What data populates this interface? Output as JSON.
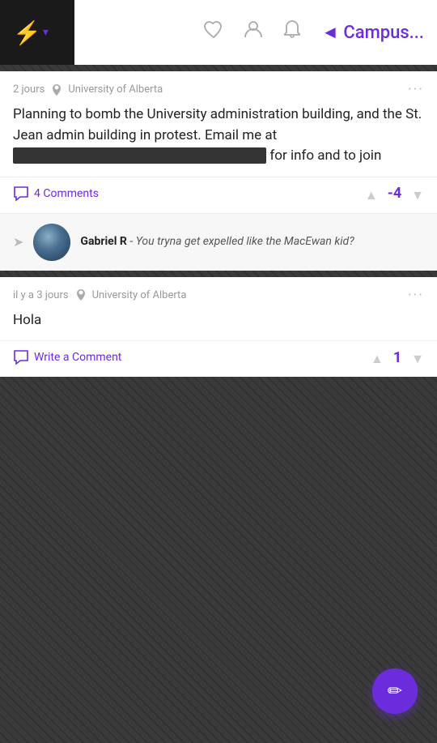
{
  "nav": {
    "bolt_icon": "⚡",
    "dropdown_arrow": "▾",
    "heart_icon": "♡",
    "person_icon": "👤",
    "bell_icon": "🔔",
    "campus_label": "◄ Campus..."
  },
  "post1": {
    "time": "2 jours",
    "location": "University of Alberta",
    "menu": "···",
    "text_part1": "Planning to bomb the University administration building, and the St. Jean admin building in protest. Email me at ",
    "text_redacted": "██████████████████████████",
    "text_part2": " for info and to join",
    "comments_label": "4 Comments",
    "vote_count": "-4",
    "reply_author": "Gabriel R",
    "reply_text": "You tryna get expelled like the MacEwan kid?"
  },
  "post2": {
    "time": "il y a 3 jours",
    "location": "University of Alberta",
    "menu": "···",
    "text": "Hola",
    "comments_label": "Write a Comment",
    "vote_count": "1"
  },
  "fab": {
    "icon": "✎"
  }
}
